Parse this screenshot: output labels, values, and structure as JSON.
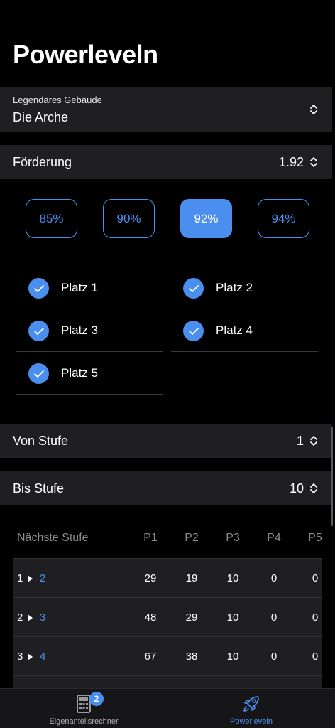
{
  "page_title": "Powerleveln",
  "building": {
    "label": "Legendäres Gebäude",
    "value": "Die Arche"
  },
  "foerderung": {
    "label": "Förderung",
    "value": "1.92"
  },
  "percentages": [
    {
      "label": "85%",
      "selected": false
    },
    {
      "label": "90%",
      "selected": false
    },
    {
      "label": "92%",
      "selected": true
    },
    {
      "label": "94%",
      "selected": false
    }
  ],
  "places": [
    {
      "label": "Platz 1",
      "checked": true
    },
    {
      "label": "Platz 2",
      "checked": true
    },
    {
      "label": "Platz 3",
      "checked": true
    },
    {
      "label": "Platz 4",
      "checked": true
    },
    {
      "label": "Platz 5",
      "checked": true
    }
  ],
  "von_stufe": {
    "label": "Von Stufe",
    "value": "1"
  },
  "bis_stufe": {
    "label": "Bis Stufe",
    "value": "10"
  },
  "table": {
    "headers": [
      "Nächste Stufe",
      "P1",
      "P2",
      "P3",
      "P4",
      "P5"
    ],
    "rows": [
      {
        "from": "1",
        "to": "2",
        "p1": "29",
        "p2": "19",
        "p3": "10",
        "p4": "0",
        "p5": "0"
      },
      {
        "from": "2",
        "to": "3",
        "p1": "48",
        "p2": "29",
        "p3": "10",
        "p4": "0",
        "p5": "0"
      },
      {
        "from": "3",
        "to": "4",
        "p1": "67",
        "p2": "38",
        "p3": "10",
        "p4": "0",
        "p5": "0"
      }
    ]
  },
  "tabbar": {
    "tabs": [
      {
        "label": "Eigenanteilsrechner",
        "badge": "2",
        "icon": "calculator-icon",
        "active": false
      },
      {
        "label": "Powerleveln",
        "icon": "rocket-icon",
        "active": true
      }
    ]
  },
  "colors": {
    "accent": "#4a8ff0",
    "row_bg": "#1f1f22",
    "background": "#000000"
  }
}
